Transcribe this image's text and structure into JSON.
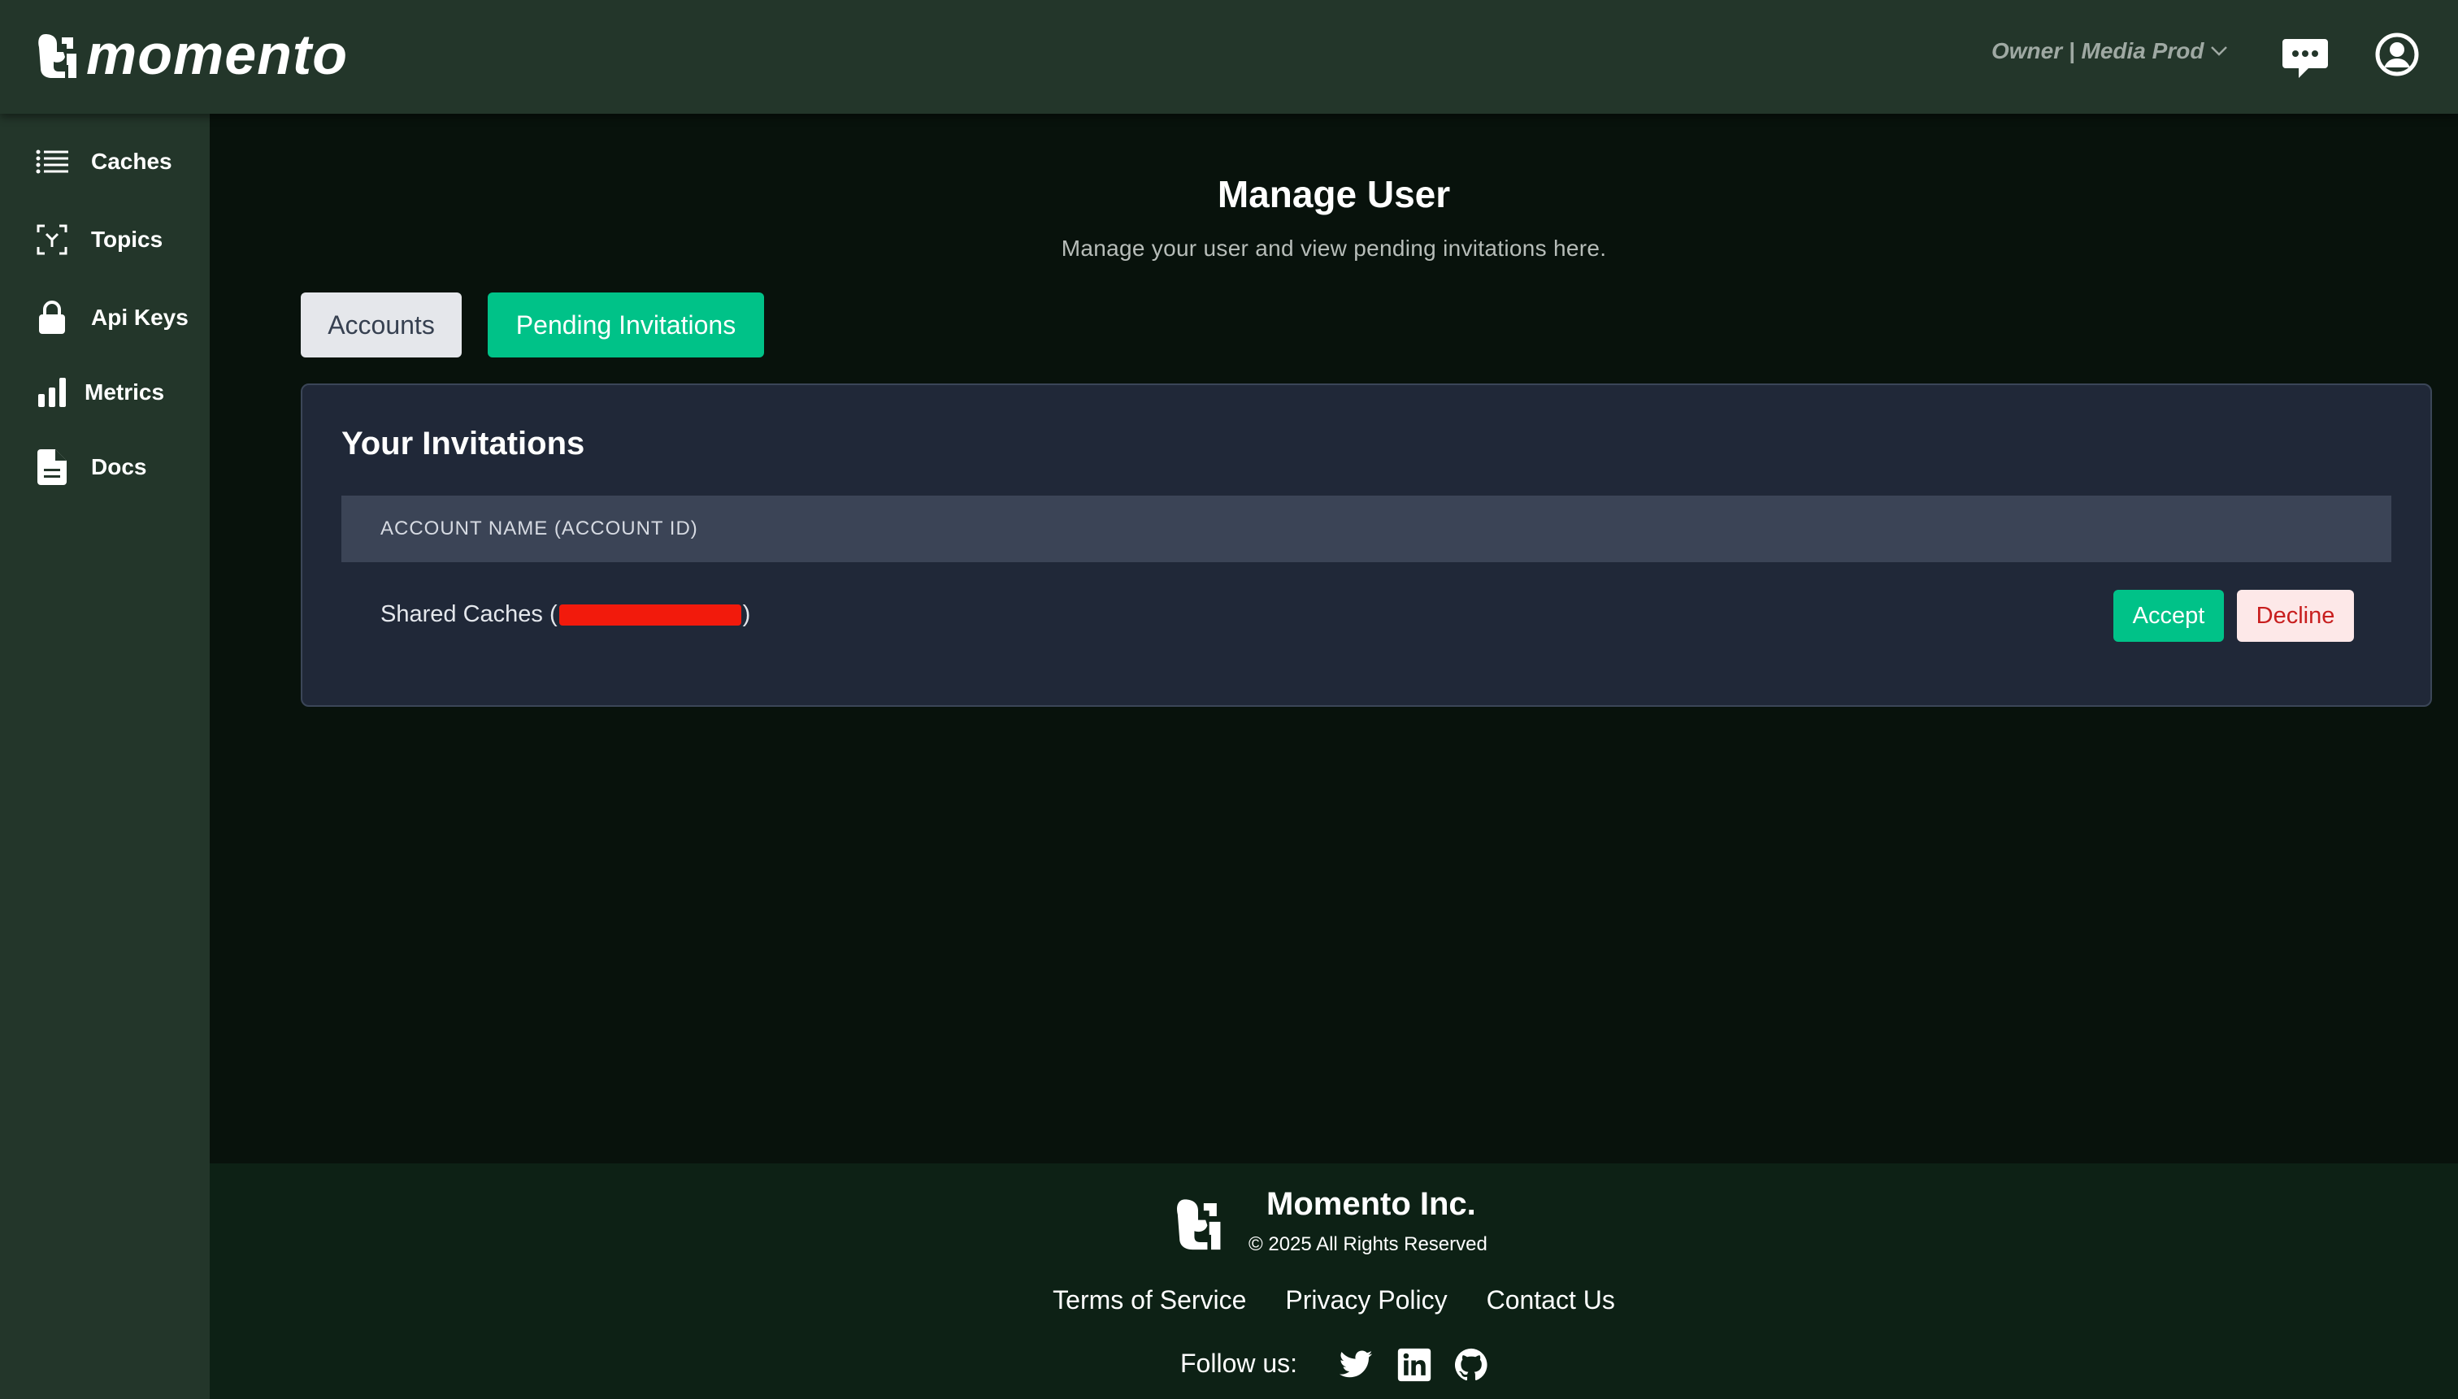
{
  "header": {
    "brand": "momento",
    "org_selector": "Owner | Media Prod",
    "icons": [
      "momento-logo-icon",
      "chevron-down-icon",
      "chat-icon",
      "user-circle-icon"
    ]
  },
  "sidebar": {
    "items": [
      {
        "label": "Caches",
        "icon": "list-icon"
      },
      {
        "label": "Topics",
        "icon": "topics-icon"
      },
      {
        "label": "Api Keys",
        "icon": "lock-icon"
      },
      {
        "label": "Metrics",
        "icon": "bar-chart-icon"
      },
      {
        "label": "Docs",
        "icon": "document-icon"
      }
    ]
  },
  "main": {
    "title": "Manage User",
    "subtitle": "Manage your user and view pending invitations here.",
    "tabs": [
      {
        "label": "Accounts",
        "active": false
      },
      {
        "label": "Pending Invitations",
        "active": true
      }
    ],
    "invitations": {
      "title": "Your Invitations",
      "column_header": "ACCOUNT NAME (ACCOUNT ID)",
      "rows": [
        {
          "account_name": "Shared Caches",
          "open_paren": "(",
          "close_paren": ")",
          "accept_label": "Accept",
          "decline_label": "Decline"
        }
      ]
    }
  },
  "footer": {
    "company": "Momento Inc.",
    "copyright": "© 2025 All Rights Reserved",
    "links": [
      "Terms of Service",
      "Privacy Policy",
      "Contact Us"
    ],
    "follow_label": "Follow us:",
    "social_icons": [
      "twitter-icon",
      "linkedin-icon",
      "github-icon"
    ]
  },
  "colors": {
    "accent": "#00c288",
    "sidebar_bg": "#23362a",
    "page_bg": "#08120c",
    "card_bg": "#202838",
    "decline_text": "#c81e1e"
  }
}
